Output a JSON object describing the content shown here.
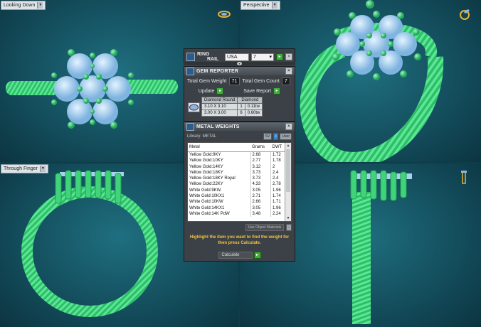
{
  "viewports": {
    "top_left": {
      "label": "Looking Down"
    },
    "top_right": {
      "label": "Perspective"
    },
    "bottom_left": {
      "label": "Through Finger"
    }
  },
  "ring_rail": {
    "title_line1": "RING",
    "title_line2": "RAIL",
    "region": "USA",
    "size": "7"
  },
  "gem_reporter": {
    "title": "GEM REPORTER",
    "total_weight_label": "Total Gem Weight",
    "total_weight_value": "71",
    "total_count_label": "Total Gem Count",
    "total_count_value": "7",
    "update_label": "Update",
    "save_report_label": "Save Report",
    "columns": [
      "Diamond Round",
      "Diamond"
    ],
    "rows": [
      {
        "size": "3.10 X 3.10",
        "qty": "1",
        "weight": "0.11tw"
      },
      {
        "size": "3.00 X 3.00",
        "qty": "6",
        "weight": "0.60tw"
      }
    ]
  },
  "metal_weights": {
    "title": "METAL WEIGHTS",
    "library_label": "Library: METAL",
    "sv_label": "SV",
    "user_label": "User",
    "columns": [
      "Metal",
      "Grams",
      "DWT"
    ],
    "rows": [
      {
        "metal": "Yellow Gold:9KY",
        "grams": "2.68",
        "dwt": "1.72"
      },
      {
        "metal": "Yellow Gold:10KY",
        "grams": "2.77",
        "dwt": "1.78"
      },
      {
        "metal": "Yellow Gold:14KY",
        "grams": "3.12",
        "dwt": "2"
      },
      {
        "metal": "Yellow Gold:18KY",
        "grams": "3.73",
        "dwt": "2.4"
      },
      {
        "metal": "Yellow Gold:18KY Royal",
        "grams": "3.73",
        "dwt": "2.4"
      },
      {
        "metal": "Yellow Gold:22KY",
        "grams": "4.33",
        "dwt": "2.78"
      },
      {
        "metal": "White Gold:9KW",
        "grams": "3.05",
        "dwt": "1.96"
      },
      {
        "metal": "White Gold:10KX1",
        "grams": "2.71",
        "dwt": "1.74"
      },
      {
        "metal": "White Gold:10KW",
        "grams": "2.66",
        "dwt": "1.71"
      },
      {
        "metal": "White Gold:14KX1",
        "grams": "3.05",
        "dwt": "1.96"
      },
      {
        "metal": "White Gold:14K PdW",
        "grams": "3.48",
        "dwt": "2.24"
      }
    ],
    "use_object_materials_label": "Use Object Materials",
    "hint": "Highlight the item you want to find the weight for then press Calculate.",
    "calculate_label": "Calculate"
  },
  "colors": {
    "metal_green": "#3fd47a",
    "gem_blue": "#a9d2f2",
    "viewport_bg": "#1b6272",
    "hint_yellow": "#f3c43a"
  }
}
